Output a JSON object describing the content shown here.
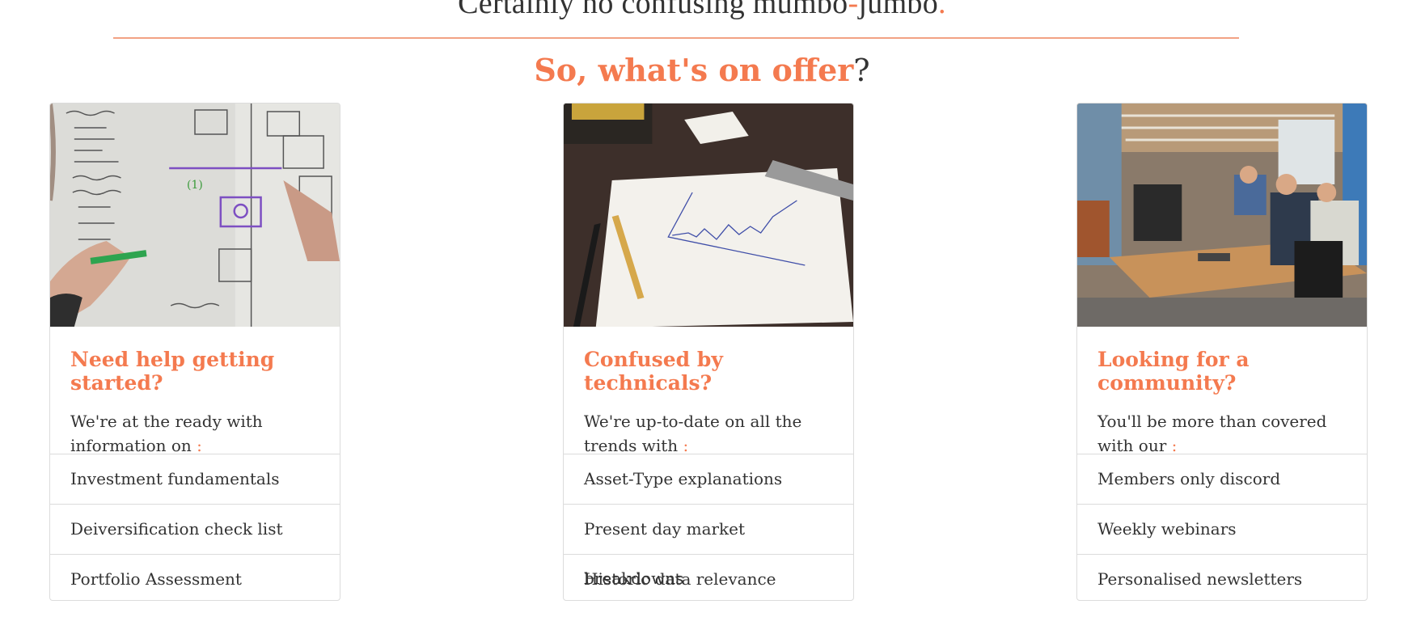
{
  "header": {
    "tagline_part1": "Certainly no confusing mumbo",
    "tagline_dash": "-",
    "tagline_part2": "jumbo",
    "tagline_period": ".",
    "offer_heading": "So, what's on offer",
    "offer_q": "?"
  },
  "colors": {
    "accent": "#f47a4f",
    "divider": "#f2a284",
    "border": "#dcdcdc"
  },
  "cards": [
    {
      "image": "whiteboard-planning-photo",
      "title": "Need help getting started?",
      "text": "We're at the ready with information on",
      "colon": ":",
      "items": [
        "Investment fundamentals",
        "Deiversification check list",
        "Portfolio Assessment"
      ]
    },
    {
      "image": "chart-on-paper-photo",
      "title": "Confused by technicals?",
      "text": "We're up-to-date on all the trends with",
      "colon": ":",
      "items": [
        "Asset-Type explanations",
        "Present day market breakdowns",
        "Historic data relevance"
      ]
    },
    {
      "image": "office-community-photo",
      "title": "Looking for a community?",
      "text": "You'll be more than covered with our",
      "colon": ":",
      "items": [
        "Members only discord",
        "Weekly webinars",
        "Personalised newsletters"
      ]
    }
  ]
}
